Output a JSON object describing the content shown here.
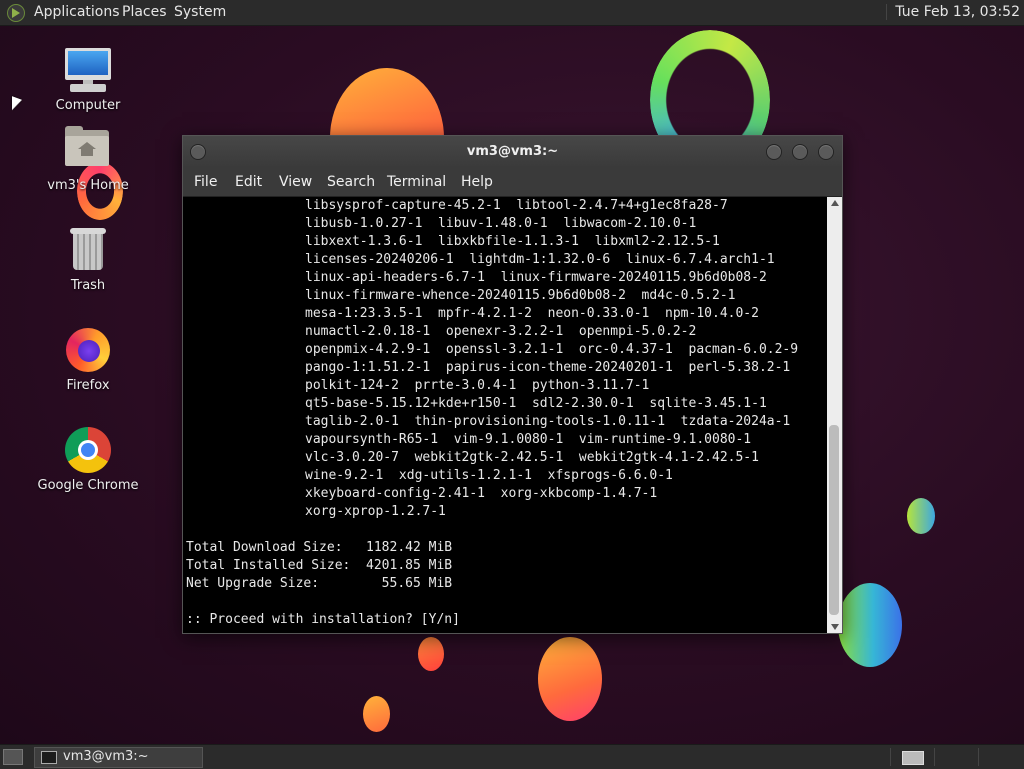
{
  "top_panel": {
    "menus": [
      "Applications",
      "Places",
      "System"
    ],
    "clock": "Tue Feb 13, 03:52"
  },
  "desktop": {
    "icons": [
      {
        "label": "Computer",
        "icon": "computer-icon"
      },
      {
        "label": "vm3's Home",
        "icon": "home-folder-icon"
      },
      {
        "label": "Trash",
        "icon": "trash-icon"
      },
      {
        "label": "Firefox",
        "icon": "firefox-icon"
      },
      {
        "label": "Google Chrome",
        "icon": "chrome-icon"
      }
    ]
  },
  "terminal": {
    "title": "vm3@vm3:~",
    "menu": [
      "File",
      "Edit",
      "View",
      "Search",
      "Terminal",
      "Help"
    ],
    "package_lines": [
      "libsysprof-capture-45.2-1  libtool-2.4.7+4+g1ec8fa28-7",
      "libusb-1.0.27-1  libuv-1.48.0-1  libwacom-2.10.0-1",
      "libxext-1.3.6-1  libxkbfile-1.1.3-1  libxml2-2.12.5-1",
      "licenses-20240206-1  lightdm-1:1.32.0-6  linux-6.7.4.arch1-1",
      "linux-api-headers-6.7-1  linux-firmware-20240115.9b6d0b08-2",
      "linux-firmware-whence-20240115.9b6d0b08-2  md4c-0.5.2-1",
      "mesa-1:23.3.5-1  mpfr-4.2.1-2  neon-0.33.0-1  npm-10.4.0-2",
      "numactl-2.0.18-1  openexr-3.2.2-1  openmpi-5.0.2-2",
      "openpmix-4.2.9-1  openssl-3.2.1-1  orc-0.4.37-1  pacman-6.0.2-9",
      "pango-1:1.51.2-1  papirus-icon-theme-20240201-1  perl-5.38.2-1",
      "polkit-124-2  prrte-3.0.4-1  python-3.11.7-1",
      "qt5-base-5.15.12+kde+r150-1  sdl2-2.30.0-1  sqlite-3.45.1-1",
      "taglib-2.0-1  thin-provisioning-tools-1.0.11-1  tzdata-2024a-1",
      "vapoursynth-R65-1  vim-9.1.0080-1  vim-runtime-9.1.0080-1",
      "vlc-3.0.20-7  webkit2gtk-2.42.5-1  webkit2gtk-4.1-2.42.5-1",
      "wine-9.2-1  xdg-utils-1.2.1-1  xfsprogs-6.6.0-1",
      "xkeyboard-config-2.41-1  xorg-xkbcomp-1.4.7-1",
      "xorg-xprop-1.2.7-1"
    ],
    "summary": [
      "Total Download Size:   1182.42 MiB",
      "Total Installed Size:  4201.85 MiB",
      "Net Upgrade Size:        55.65 MiB"
    ],
    "prompt": ":: Proceed with installation? [Y/n]"
  },
  "bottom_panel": {
    "task_label": "vm3@vm3:~"
  }
}
